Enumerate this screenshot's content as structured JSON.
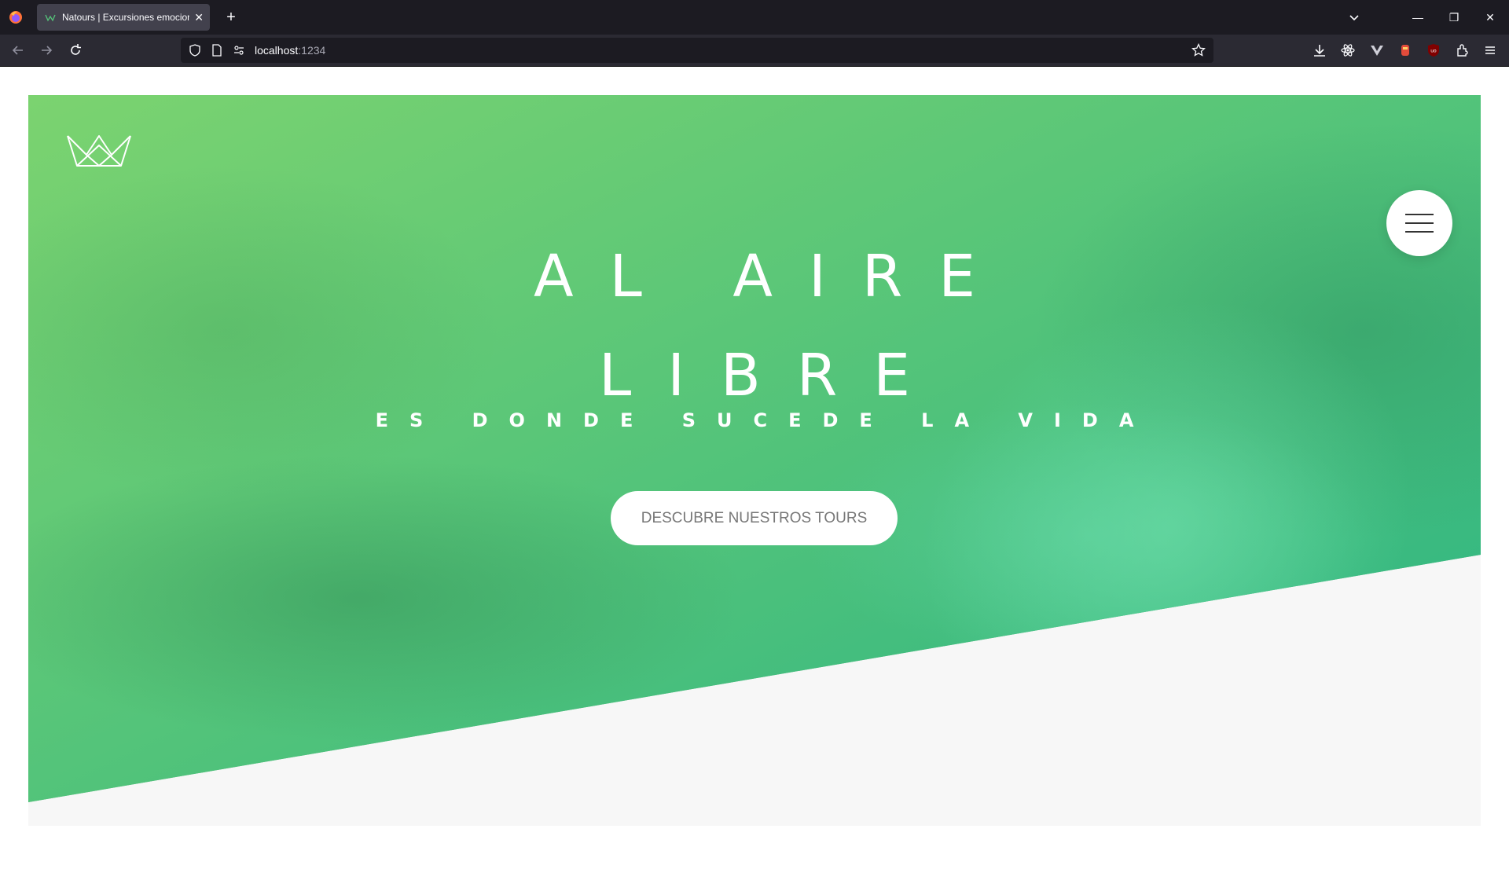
{
  "browser": {
    "tab_title": "Natours | Excursiones emocionantes",
    "url_host": "localhost",
    "url_port": ":1234",
    "new_tab_symbol": "+",
    "close_tab_symbol": "✕",
    "window_minimize": "—",
    "window_restore": "❐",
    "window_close": "✕",
    "icons": [
      "back-icon",
      "forward-icon",
      "reload-icon",
      "shield-icon",
      "page-icon",
      "permissions-icon",
      "bookmark-star-icon",
      "download-icon",
      "extension-icon",
      "menu-icon"
    ]
  },
  "hero": {
    "heading_line_1": "AL AIRE",
    "heading_line_2": "LIBRE",
    "subheading": "ES DONDE SUCEDE LA VIDA",
    "cta_label": "DESCUBRE NUESTROS TOURS"
  },
  "colors": {
    "gradient_start": "#7ed56f",
    "gradient_end": "#28b485",
    "section_bg": "#f7f7f7",
    "button_text": "#777777"
  }
}
